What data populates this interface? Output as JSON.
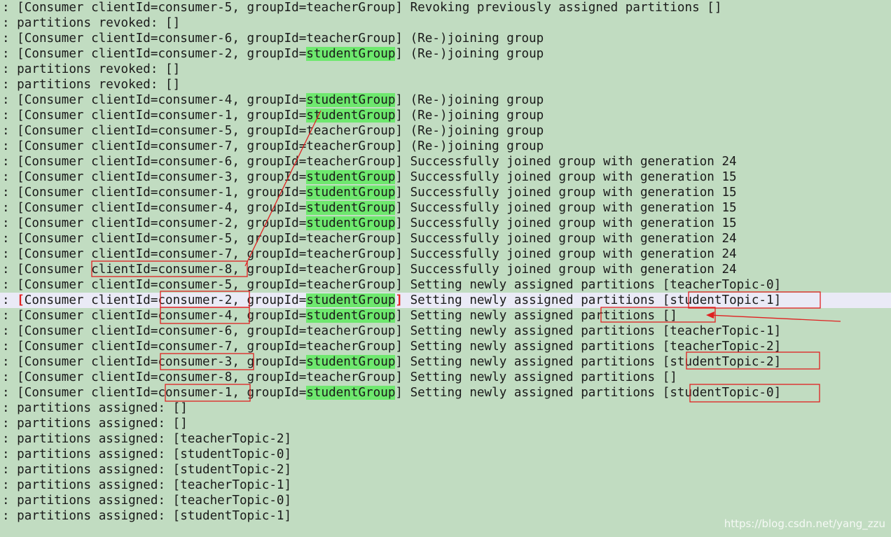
{
  "log": {
    "lines": [
      [
        {
          "t": ": [Consumer clientId=consumer-5, groupId=teacherGroup] Revoking previously assigned partitions []"
        }
      ],
      [
        {
          "t": ": partitions revoked: []"
        }
      ],
      [
        {
          "t": ": [Consumer clientId=consumer-6, groupId=teacherGroup] (Re-)joining group"
        }
      ],
      [
        {
          "t": ": [Consumer clientId=consumer-2, groupId="
        },
        {
          "t": "studentGroup",
          "hl": true
        },
        {
          "t": "] (Re-)joining group"
        }
      ],
      [
        {
          "t": ": partitions revoked: []"
        }
      ],
      [
        {
          "t": ": partitions revoked: []"
        }
      ],
      [
        {
          "t": ": [Consumer clientId=consumer-4, groupId="
        },
        {
          "t": "studentGroup",
          "hl": true
        },
        {
          "t": "] (Re-)joining group"
        }
      ],
      [
        {
          "t": ": [Consumer clientId=consumer-1, groupId="
        },
        {
          "t": "studentGroup",
          "hl": true
        },
        {
          "t": "] (Re-)joining group"
        }
      ],
      [
        {
          "t": ": [Consumer clientId=consumer-5, groupId=teacherGroup] (Re-)joining group"
        }
      ],
      [
        {
          "t": ": [Consumer clientId=consumer-7, groupId=teacherGroup] (Re-)joining group"
        }
      ],
      [
        {
          "t": ": [Consumer clientId=consumer-6, groupId=teacherGroup] Successfully joined group with generation 24"
        }
      ],
      [
        {
          "t": ": [Consumer clientId=consumer-3, groupId="
        },
        {
          "t": "studentGroup",
          "hl": true
        },
        {
          "t": "] Successfully joined group with generation 15"
        }
      ],
      [
        {
          "t": ": [Consumer clientId=consumer-1, groupId="
        },
        {
          "t": "studentGroup",
          "hl": true
        },
        {
          "t": "] Successfully joined group with generation 15"
        }
      ],
      [
        {
          "t": ": [Consumer clientId=consumer-4, groupId="
        },
        {
          "t": "studentGroup",
          "hl": true
        },
        {
          "t": "] Successfully joined group with generation 15"
        }
      ],
      [
        {
          "t": ": [Consumer clientId=consumer-2, groupId="
        },
        {
          "t": "studentGroup",
          "hl": true
        },
        {
          "t": "] Successfully joined group with generation 15"
        }
      ],
      [
        {
          "t": ": [Consumer clientId=consumer-5, groupId=teacherGroup] Successfully joined group with generation 24"
        }
      ],
      [
        {
          "t": ": [Consumer clientId=consumer-7, groupId=teacherGroup] Successfully joined group with generation 24"
        }
      ],
      [
        {
          "t": ": [Consumer clientId=consumer-8, groupId=teacherGroup] Successfully joined group with generation 24"
        }
      ],
      [
        {
          "t": ": [Consumer clientId=consumer-5, groupId=teacherGroup] Setting newly assigned partitions [teacherTopic-0]"
        }
      ],
      [
        {
          "t": ": "
        },
        {
          "t": "[",
          "red": true
        },
        {
          "t": "Consumer clientId=consumer-2, groupId="
        },
        {
          "t": "studentGroup",
          "hl": true
        },
        {
          "t": "]",
          "red": true
        },
        {
          "t": " Setting newly assigned partitions [studentTopic-1]"
        }
      ],
      [
        {
          "t": ": [Consumer clientId=consumer-4, groupId="
        },
        {
          "t": "studentGroup",
          "hl": true
        },
        {
          "t": "] Setting newly assigned partitions []"
        }
      ],
      [
        {
          "t": ": [Consumer clientId=consumer-6, groupId=teacherGroup] Setting newly assigned partitions [teacherTopic-1]"
        }
      ],
      [
        {
          "t": ": [Consumer clientId=consumer-7, groupId=teacherGroup] Setting newly assigned partitions [teacherTopic-2]"
        }
      ],
      [
        {
          "t": ": [Consumer clientId=consumer-3, groupId="
        },
        {
          "t": "studentGroup",
          "hl": true
        },
        {
          "t": "] Setting newly assigned partitions [studentTopic-2]"
        }
      ],
      [
        {
          "t": ": [Consumer clientId=consumer-8, groupId=teacherGroup] Setting newly assigned partitions []"
        }
      ],
      [
        {
          "t": ": [Consumer clientId=consumer-1, groupId="
        },
        {
          "t": "studentGroup",
          "hl": true
        },
        {
          "t": "] Setting newly assigned partitions [studentTopic-0]"
        }
      ],
      [
        {
          "t": ": partitions assigned: []"
        }
      ],
      [
        {
          "t": ": partitions assigned: []"
        }
      ],
      [
        {
          "t": ": partitions assigned: [teacherTopic-2]"
        }
      ],
      [
        {
          "t": ": partitions assigned: [studentTopic-0]"
        }
      ],
      [
        {
          "t": ": partitions assigned: [studentTopic-2]"
        }
      ],
      [
        {
          "t": ": partitions assigned: [teacherTopic-1]"
        }
      ],
      [
        {
          "t": ": partitions assigned: [teacherTopic-0]"
        }
      ],
      [
        {
          "t": ": partitions assigned: [studentTopic-1]"
        }
      ]
    ],
    "active_line": 19
  },
  "watermark": "https://blog.csdn.net/yang_zzu",
  "colors": {
    "background": "#c1dcc1",
    "group_highlight": "#6ee86e",
    "annotation_red": "#e02020",
    "active_line": "#eaeaf6"
  }
}
